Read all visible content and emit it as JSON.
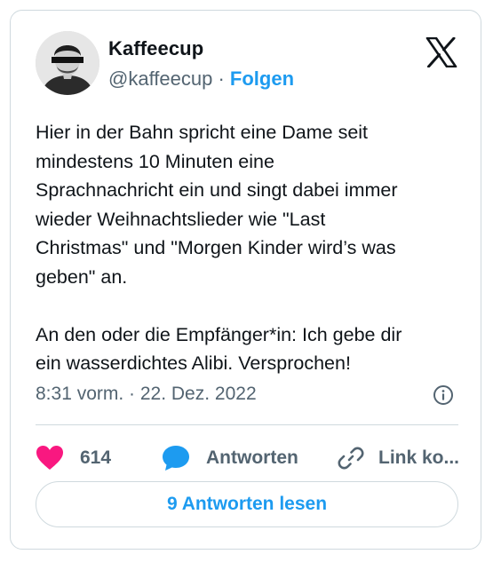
{
  "author": {
    "name": "Kaffeecup",
    "handle": "@kaffeecup",
    "separator": " · ",
    "follow_label": "Folgen"
  },
  "tweet": {
    "text": "Hier in der Bahn spricht eine Dame seit\nmindestens 10 Minuten eine\nSprachnachricht ein und singt dabei immer\nwieder Weihnachtslieder wie \"Last\nChristmas\" und \"Morgen Kinder wird’s was\ngeben\" an.\n\nAn den oder die Empfänger*in: Ich gebe dir\nein wasserdichtes Alibi. Versprochen!",
    "timestamp": "8:31 vorm. · 22. Dez. 2022"
  },
  "actions": {
    "like_count": "614",
    "reply_label": "Antworten",
    "copy_link_label": "Link ko..."
  },
  "read_replies_label": "9 Antworten lesen",
  "colors": {
    "like": "#f91880",
    "reply": "#1d9bf0",
    "accent": "#1d9bf0",
    "secondary_text": "#536471",
    "border": "#cfd9de"
  },
  "icons": [
    "x-logo-icon",
    "info-icon",
    "heart-icon",
    "reply-bubble-icon",
    "link-icon"
  ]
}
